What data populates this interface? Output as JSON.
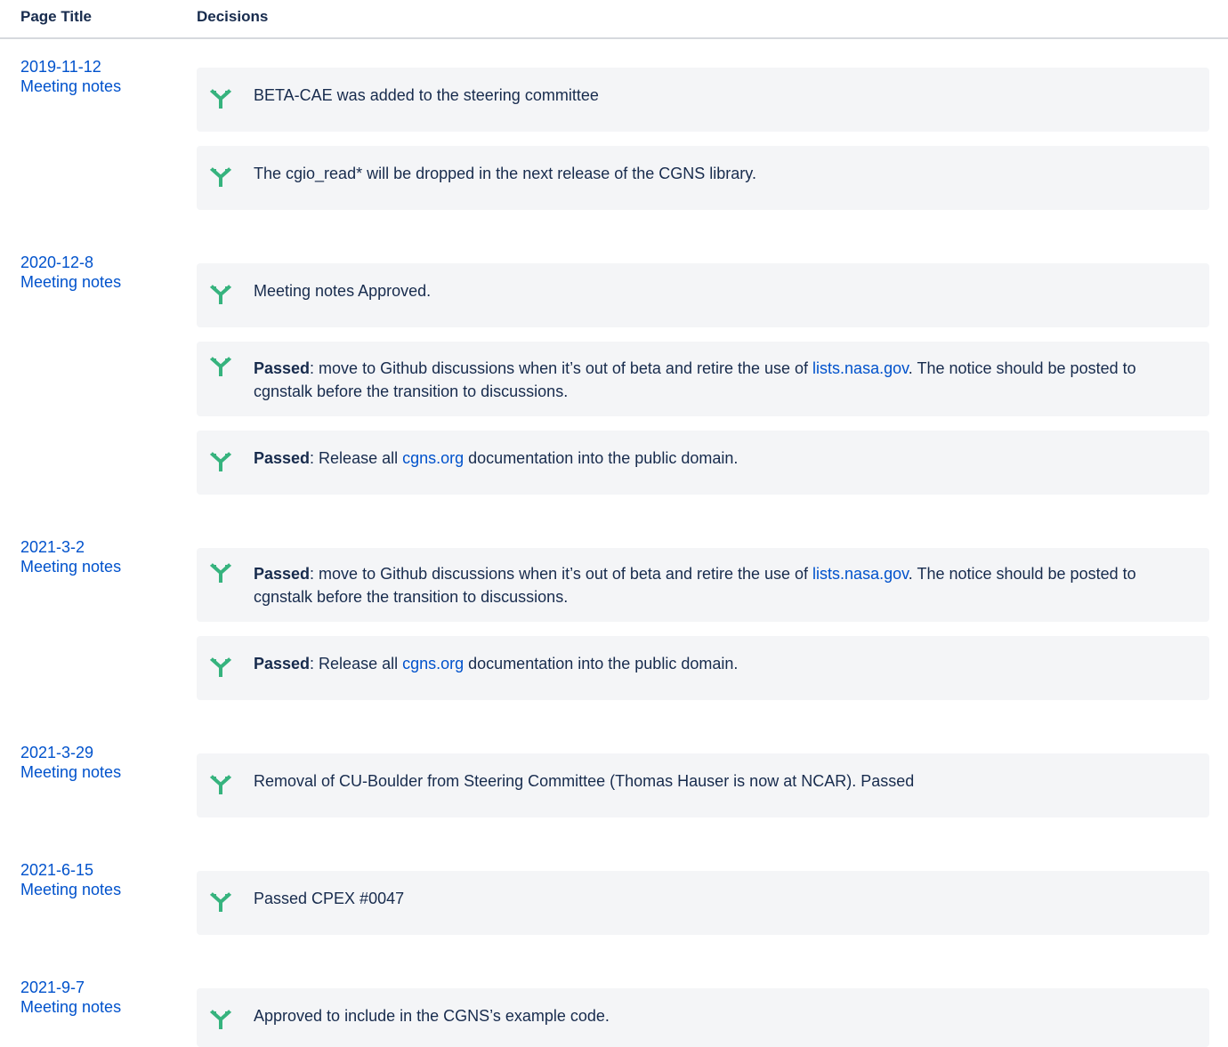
{
  "header": {
    "col_title": "Page Title",
    "col_decisions": "Decisions"
  },
  "colors": {
    "link": "#0052cc",
    "icon": "#36b37e",
    "card_bg": "#f4f5f7"
  },
  "icon_name": "decision-icon",
  "rows": [
    {
      "date": "2019-11-12",
      "page": "Meeting notes",
      "decisions": [
        {
          "text": "BETA-CAE was added to the steering committee"
        },
        {
          "text": "The cgio_read* will be dropped in the next release of the CGNS library."
        }
      ]
    },
    {
      "date": "2020-12-8",
      "page": "Meeting notes",
      "decisions": [
        {
          "text": "Meeting notes Approved."
        },
        {
          "bold": "Passed",
          "pre": ": move to Github discussions when it’s out of beta and retire the use of ",
          "link": "lists.nasa.gov",
          "post": ". The notice should be posted to cgnstalk before the transition to discussions."
        },
        {
          "bold": "Passed",
          "pre": ": Release all ",
          "link": "cgns.org",
          "post": " documentation into the public domain."
        }
      ]
    },
    {
      "date": "2021-3-2",
      "page": "Meeting notes",
      "decisions": [
        {
          "bold": "Passed",
          "pre": ": move to Github discussions when it’s out of beta and retire the use of ",
          "link": "lists.nasa.gov",
          "post": ". The notice should be posted to cgnstalk before the transition to discussions."
        },
        {
          "bold": "Passed",
          "pre": ": Release all ",
          "link": "cgns.org",
          "post": " documentation into the public domain."
        }
      ]
    },
    {
      "date": "2021-3-29",
      "page": "Meeting notes",
      "decisions": [
        {
          "text": "Removal of CU-Boulder from Steering Committee (Thomas Hauser is now at NCAR). Passed"
        }
      ]
    },
    {
      "date": "2021-6-15",
      "page": "Meeting notes",
      "decisions": [
        {
          "text": "Passed CPEX #0047"
        }
      ]
    },
    {
      "date": "2021-9-7",
      "page": "Meeting notes",
      "decisions": [
        {
          "text": "Approved to include in the CGNS’s example code."
        }
      ]
    }
  ]
}
